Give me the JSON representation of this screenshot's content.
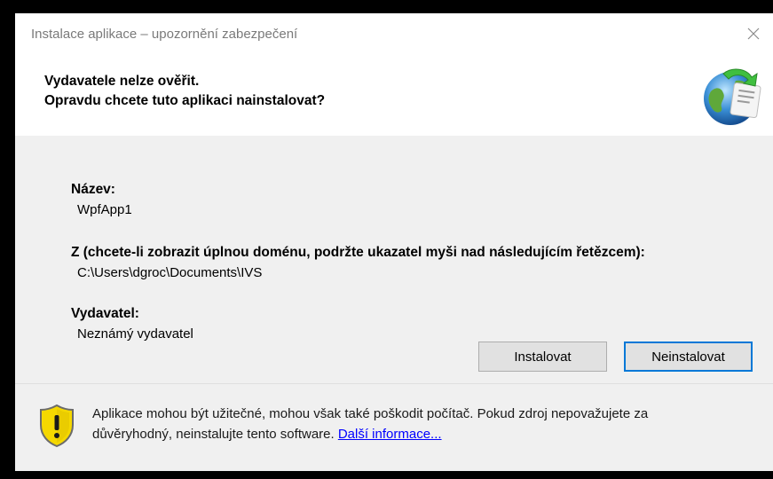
{
  "window": {
    "title": "Instalace aplikace – upozornění zabezpečení"
  },
  "header": {
    "line1": "Vydavatele nelze ověřit.",
    "line2": "Opravdu chcete tuto aplikaci nainstalovat?",
    "icon": "globe-install-icon"
  },
  "details": {
    "name_label": "Název:",
    "name_value": "WpfApp1",
    "from_label": "Z (chcete-li zobrazit úplnou doménu, podržte ukazatel myši nad následujícím řetězcem):",
    "from_value": "C:\\Users\\dgroc\\Documents\\IVS",
    "publisher_label": "Vydavatel:",
    "publisher_value": "Neznámý vydavatel"
  },
  "buttons": {
    "install": "Instalovat",
    "dont_install": "Neinstalovat"
  },
  "footer": {
    "icon": "security-shield-warning-icon",
    "warning_line1": "Aplikace mohou být užitečné, mohou však také poškodit počítač. Pokud zdroj nepovažujete za",
    "warning_line2": "důvěryhodný, neinstalujte tento software.",
    "more_info_link": "Další informace..."
  },
  "colors": {
    "default_button_border": "#0078d7",
    "link": "#0000ff",
    "shield_yellow": "#f5d800"
  }
}
